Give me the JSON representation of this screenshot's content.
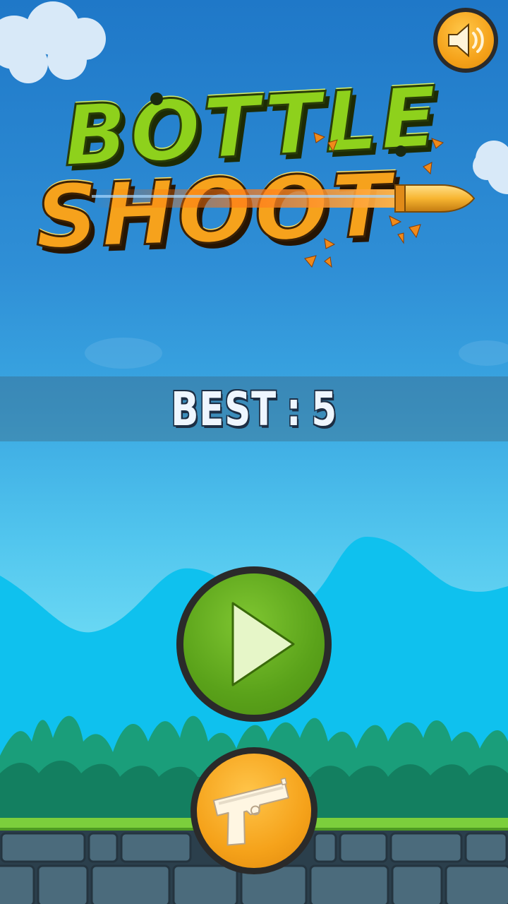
{
  "game": {
    "title_line1": "BOTTLE",
    "title_line2": "SHOOT",
    "best_label": "BEST",
    "best_separator": ":",
    "best_value": "5"
  },
  "buttons": {
    "sound": {
      "icon": "speaker-icon"
    },
    "play": {
      "icon": "play-icon"
    },
    "weapon": {
      "icon": "pistol-icon"
    }
  },
  "colors": {
    "sky_top": "#1f78c8",
    "sky_bottom": "#86eaf8",
    "title_green": "#8ed11c",
    "title_orange": "#f6a21c",
    "play_green": "#5aa21a",
    "button_orange": "#f5a21a",
    "ground_stone": "#3e5a6a",
    "grass": "#7ccf3c"
  }
}
